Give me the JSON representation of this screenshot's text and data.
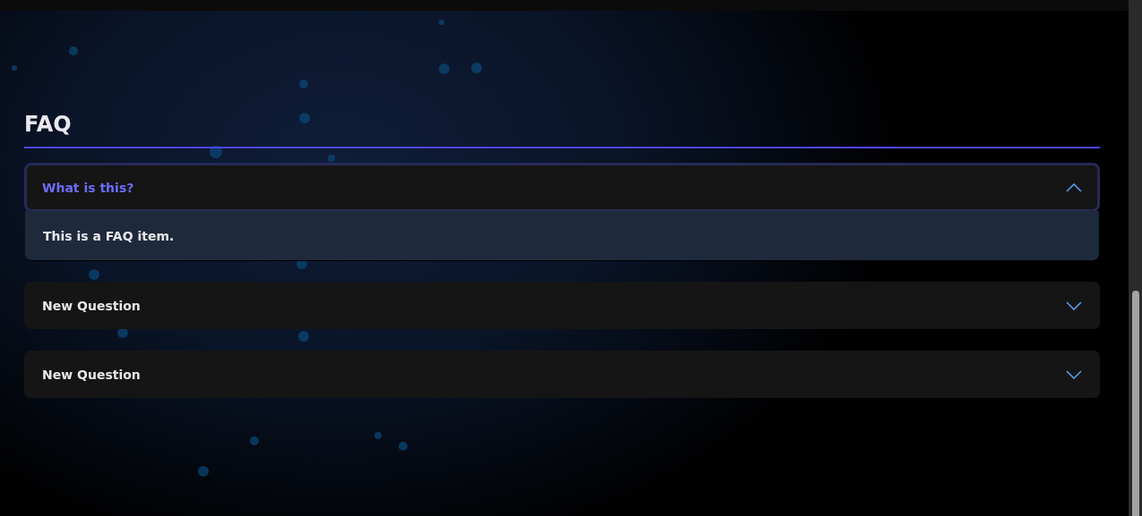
{
  "heading": "FAQ",
  "items": [
    {
      "question": "What is this?",
      "expanded": true,
      "answer": "This is a FAQ item."
    },
    {
      "question": "New Question",
      "expanded": false
    },
    {
      "question": "New Question",
      "expanded": false
    }
  ]
}
